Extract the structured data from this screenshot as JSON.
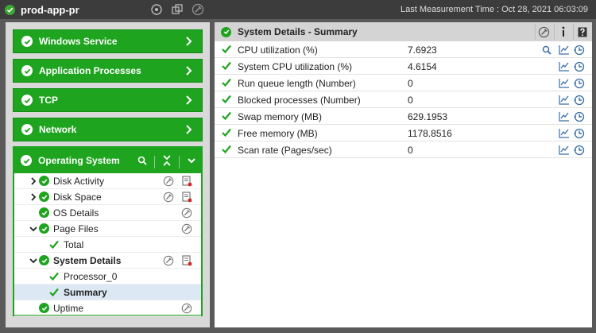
{
  "titlebar": {
    "app_title": "prod-app-pr",
    "measurement_label": "Last Measurement Time : Oct 28, 2021 06:03:09",
    "icons": [
      "refresh-settings-icon",
      "copy-window-icon",
      "tools-icon"
    ]
  },
  "left": {
    "groups": [
      {
        "label": "Windows Service",
        "icon": "chevron-right-icon"
      },
      {
        "label": "Application Processes",
        "icon": "chevron-right-icon"
      },
      {
        "label": "TCP",
        "icon": "chevron-right-icon"
      },
      {
        "label": "Network",
        "icon": "chevron-right-icon"
      }
    ],
    "os": {
      "label": "Operating System",
      "tree": [
        {
          "label": "Disk Activity"
        },
        {
          "label": "Disk Space"
        },
        {
          "label": "OS Details"
        },
        {
          "label": "Page Files"
        },
        {
          "label": "Total"
        },
        {
          "label": "System Details"
        },
        {
          "label": "Processor_0"
        },
        {
          "label": "Summary"
        },
        {
          "label": "Uptime"
        }
      ]
    }
  },
  "right": {
    "title": "System Details - Summary",
    "metrics": [
      {
        "name": "CPU utilization (%)",
        "value": "7.6923"
      },
      {
        "name": "System CPU utilization (%)",
        "value": "4.6154"
      },
      {
        "name": "Run queue length (Number)",
        "value": "0"
      },
      {
        "name": "Blocked processes (Number)",
        "value": "0"
      },
      {
        "name": "Swap memory (MB)",
        "value": "629.1953"
      },
      {
        "name": "Free memory (MB)",
        "value": "1178.8516"
      },
      {
        "name": "Scan rate (Pages/sec)",
        "value": "0"
      }
    ]
  },
  "colors": {
    "accent_green": "#1ea41e",
    "titlebar": "#3c3c3c",
    "selected_row": "#dce9f5"
  }
}
